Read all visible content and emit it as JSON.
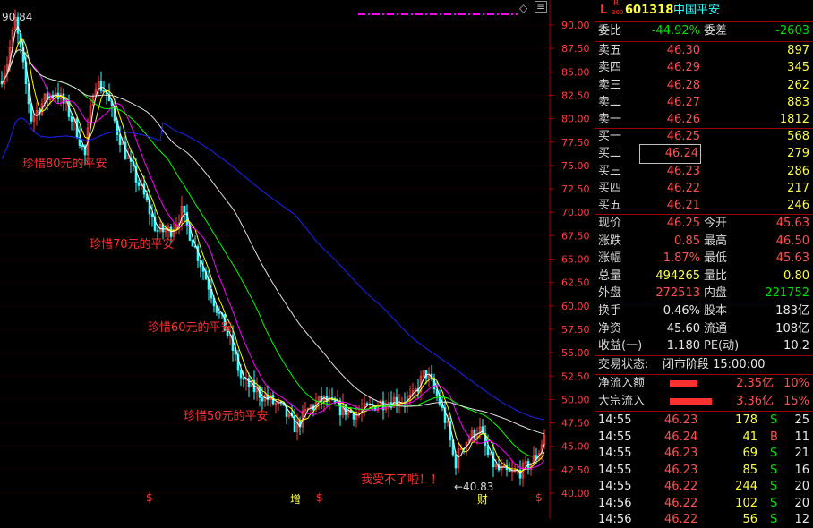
{
  "chart": {
    "high_label": "90.84",
    "low_label": "←40.83",
    "y_ticks": [
      "90.00",
      "87.50",
      "85.00",
      "82.50",
      "80.00",
      "77.50",
      "75.00",
      "72.50",
      "70.00",
      "67.50",
      "65.00",
      "62.50",
      "60.00",
      "57.50",
      "55.00",
      "52.50",
      "50.00",
      "47.50",
      "45.00",
      "42.50",
      "40.00"
    ],
    "annotations": [
      "珍惜80元的平安",
      "珍惜70元的平安",
      "珍惜60元的平安",
      "珍惜50元的平安",
      "我受不了啦！！"
    ],
    "bottom_markers": [
      "$",
      "增",
      "$",
      "财",
      "$"
    ],
    "top_icons": [
      "◇",
      "≡"
    ],
    "colors": {
      "up": "#ff4040",
      "down": "#30ffff",
      "ma5": "#ffffff",
      "ma10": "#ffff00",
      "ma20": "#ff00ff",
      "ma60": "#00ff00",
      "ma120": "#e0e0e0",
      "ma250": "#2020ff"
    }
  },
  "quote": {
    "header": {
      "flag_l": "L",
      "flag_r": "R",
      "flag_sub": "300",
      "code": "601318",
      "name": "中国平安"
    },
    "webi": {
      "label": "委比",
      "value": "-44.92%",
      "label2": "委差",
      "value2": "-2603"
    },
    "asks": [
      {
        "label": "卖五",
        "price": "46.30",
        "vol": "897"
      },
      {
        "label": "卖四",
        "price": "46.29",
        "vol": "345"
      },
      {
        "label": "卖三",
        "price": "46.28",
        "vol": "262"
      },
      {
        "label": "卖二",
        "price": "46.27",
        "vol": "883"
      },
      {
        "label": "卖一",
        "price": "46.26",
        "vol": "1812"
      }
    ],
    "bids": [
      {
        "label": "买一",
        "price": "46.25",
        "vol": "568"
      },
      {
        "label": "买二",
        "price": "46.24",
        "vol": "279"
      },
      {
        "label": "买三",
        "price": "46.23",
        "vol": "286"
      },
      {
        "label": "买四",
        "price": "46.22",
        "vol": "217"
      },
      {
        "label": "买五",
        "price": "46.21",
        "vol": "246"
      }
    ],
    "stats": [
      {
        "l1": "现价",
        "v1": "46.25",
        "l2": "今开",
        "v2": "45.63"
      },
      {
        "l1": "涨跌",
        "v1": "0.85",
        "l2": "最高",
        "v2": "46.50"
      },
      {
        "l1": "涨幅",
        "v1": "1.87%",
        "l2": "最低",
        "v2": "45.63"
      },
      {
        "l1": "总量",
        "v1": "494265",
        "l2": "量比",
        "v2": "0.80"
      },
      {
        "l1": "外盘",
        "v1": "272513",
        "l2": "内盘",
        "v2": "221752"
      }
    ],
    "fin": [
      {
        "l1": "换手",
        "v1": "0.46%",
        "l2": "股本",
        "v2": "183亿"
      },
      {
        "l1": "净资",
        "v1": "45.60",
        "l2": "流通",
        "v2": "108亿"
      },
      {
        "l1": "收益(一)",
        "v1": "1.180",
        "l2": "PE(动)",
        "v2": "10.2"
      }
    ],
    "status": {
      "label": "交易状态:",
      "value": "闭市阶段 15:00:00"
    },
    "flows": [
      {
        "label": "净流入额",
        "value": "2.35亿",
        "pct": "10%",
        "bar": 0.1
      },
      {
        "label": "大宗流入",
        "value": "3.36亿",
        "pct": "15%",
        "bar": 0.15
      }
    ],
    "trades": [
      {
        "time": "14:55",
        "price": "46.23",
        "vol": "178",
        "side": "S",
        "n": "25"
      },
      {
        "time": "14:55",
        "price": "46.24",
        "vol": "41",
        "side": "B",
        "n": "11"
      },
      {
        "time": "14:55",
        "price": "46.23",
        "vol": "69",
        "side": "S",
        "n": "21"
      },
      {
        "time": "14:55",
        "price": "46.23",
        "vol": "85",
        "side": "S",
        "n": "16"
      },
      {
        "time": "14:55",
        "price": "46.22",
        "vol": "244",
        "side": "S",
        "n": "20"
      },
      {
        "time": "14:56",
        "price": "46.22",
        "vol": "102",
        "side": "S",
        "n": "20"
      },
      {
        "time": "14:56",
        "price": "46.22",
        "vol": "56",
        "side": "S",
        "n": "12"
      }
    ]
  }
}
